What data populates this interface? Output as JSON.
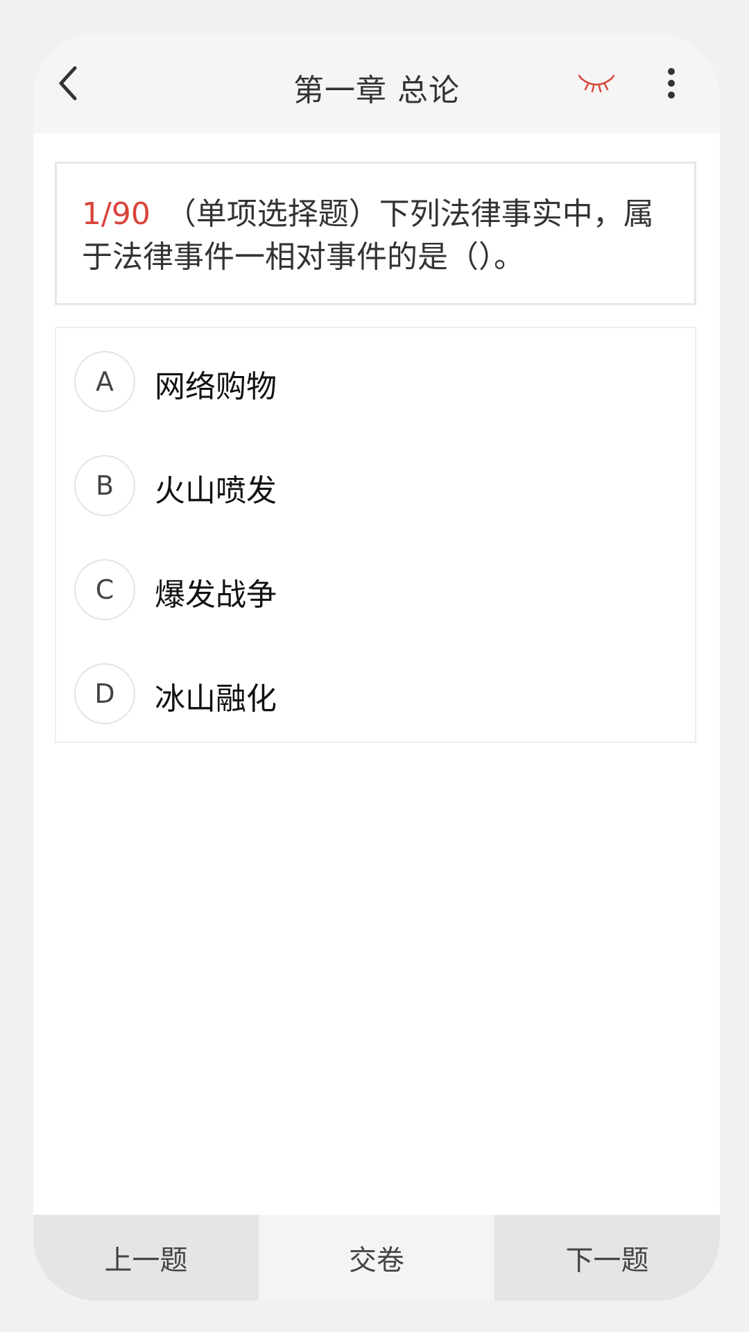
{
  "header": {
    "title": "第一章 总论",
    "back_icon": "chevron-left-icon",
    "eye_icon": "eye-closed-icon",
    "more_icon": "more-vertical-icon",
    "accent_color": "#d9433a"
  },
  "question": {
    "number": "1/90",
    "text": "（单项选择题）下列法律事实中，属于法律事件一相对事件的是（）。"
  },
  "options": [
    {
      "letter": "A",
      "text": "网络购物"
    },
    {
      "letter": "B",
      "text": "火山喷发"
    },
    {
      "letter": "C",
      "text": "爆发战争"
    },
    {
      "letter": "D",
      "text": "冰山融化"
    }
  ],
  "footer": {
    "prev_label": "上一题",
    "submit_label": "交卷",
    "next_label": "下一题"
  }
}
